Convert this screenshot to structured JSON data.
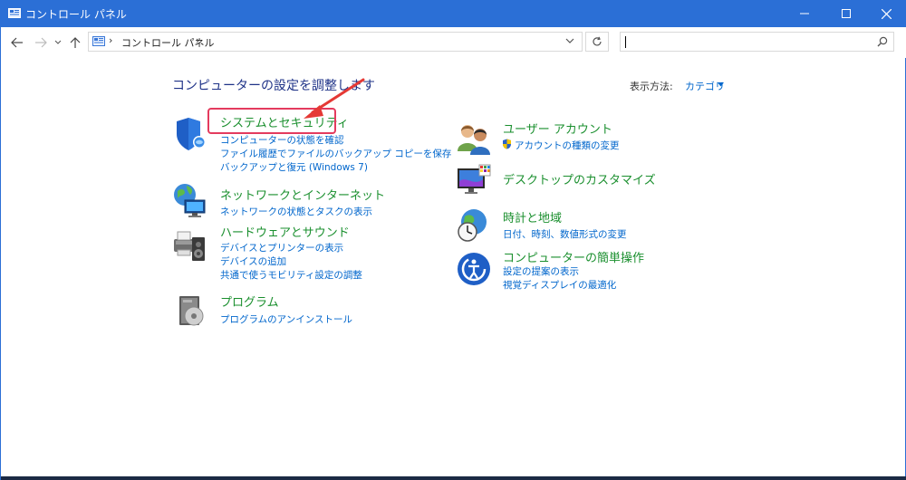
{
  "window": {
    "title": "コントロール パネル",
    "controls": {
      "minimize": "minimize",
      "maximize": "maximize",
      "close": "close"
    }
  },
  "nav": {
    "breadcrumb_sep": "›",
    "breadcrumb": [
      "コントロール パネル"
    ],
    "search_placeholder": ""
  },
  "main": {
    "title": "コンピューターの設定を調整します",
    "view_by_label": "表示方法:",
    "view_by_value": "カテゴリ",
    "left": [
      {
        "title": "システムとセキュリティ",
        "icon": "shield-icon",
        "links": [
          "コンピューターの状態を確認",
          "ファイル履歴でファイルのバックアップ コピーを保存",
          "バックアップと復元 (Windows 7)"
        ]
      },
      {
        "title": "ネットワークとインターネット",
        "icon": "network-globe-icon",
        "links": [
          "ネットワークの状態とタスクの表示"
        ]
      },
      {
        "title": "ハードウェアとサウンド",
        "icon": "printer-speaker-icon",
        "links": [
          "デバイスとプリンターの表示",
          "デバイスの追加",
          "共通で使うモビリティ設定の調整"
        ]
      },
      {
        "title": "プログラム",
        "icon": "program-disc-icon",
        "links": [
          "プログラムのアンインストール"
        ]
      }
    ],
    "right": [
      {
        "title": "ユーザー アカウント",
        "icon": "users-icon",
        "links": [
          "アカウントの種類の変更"
        ]
      },
      {
        "title": "デスクトップのカスタマイズ",
        "icon": "monitor-palette-icon",
        "links": []
      },
      {
        "title": "時計と地域",
        "icon": "clock-globe-icon",
        "links": [
          "日付、時刻、数値形式の変更"
        ]
      },
      {
        "title": "コンピューターの簡単操作",
        "icon": "ease-of-access-icon",
        "links": [
          "設定の提案の表示",
          "視覚ディスプレイの最適化"
        ]
      }
    ]
  },
  "colors": {
    "titlebar": "#2b6fd6",
    "category_title": "#1a8f2e",
    "link": "#0066cc",
    "highlight": "#e43b5e"
  }
}
